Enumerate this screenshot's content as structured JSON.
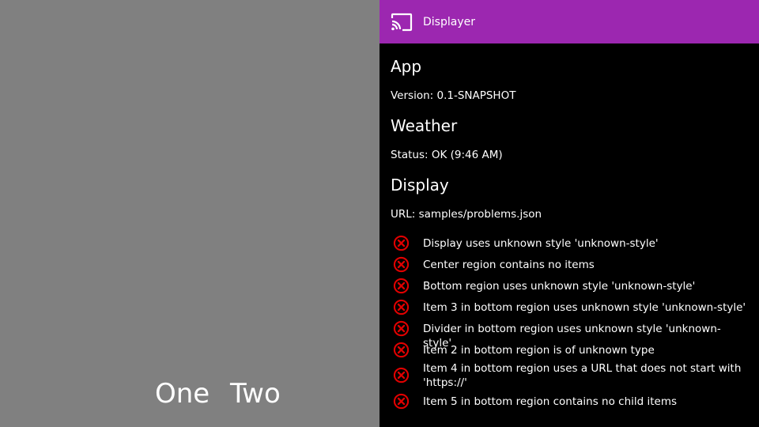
{
  "display": {
    "bottom_items": [
      "One",
      "Two"
    ]
  },
  "panel": {
    "app_bar_title": "Displayer",
    "sections": {
      "app_heading": "App",
      "version_text": "Version: 0.1-SNAPSHOT",
      "weather_heading": "Weather",
      "status_text": "Status: OK (9:46 AM)",
      "display_heading": "Display",
      "url_text": "URL: samples/problems.json"
    },
    "problems": [
      "Display uses unknown style 'unknown-style'",
      "Center region contains no items",
      "Bottom region uses unknown style 'unknown-style'",
      "Item 3 in bottom region uses unknown style 'unknown-style'",
      "Divider in bottom region uses unknown style 'unknown-style'",
      "Item 2 in bottom region is of unknown type",
      "Item 4 in bottom region uses a URL that does not start with 'https://'",
      "Item 5 in bottom region contains no child items"
    ]
  },
  "colors": {
    "app_bar": "#9c27b0",
    "panel_background": "#000000",
    "display_background": "#808080",
    "error_icon": "#e00000"
  },
  "icons": {
    "app_bar": "cast-icon",
    "problem": "error-circle-x-icon"
  }
}
